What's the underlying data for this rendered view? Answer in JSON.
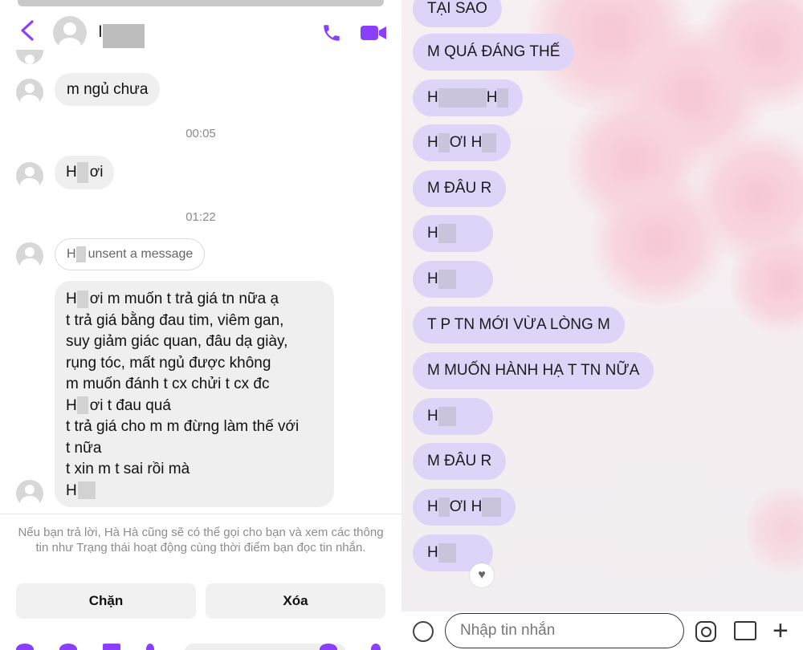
{
  "left": {
    "header": {
      "name_initial": "I",
      "call_icon": "phone-icon",
      "video_icon": "video-call-icon",
      "back_icon": "chevron-left-icon"
    },
    "messages": [
      {
        "text": "m ngủ chưa"
      },
      {
        "time": "00:05"
      },
      {
        "prefix": "H",
        "text": "ơi"
      },
      {
        "time": "01:22"
      },
      {
        "prefix": "H",
        "text": "unsent a message"
      }
    ],
    "long_message": [
      {
        "prefix": "H",
        "text": "ơi m muốn t trả giá tn nữa ạ"
      },
      {
        "text": "t trả giá bằng đau tim, viêm gan,"
      },
      {
        "text": "suy giảm giác quan, đâu dạ giày,"
      },
      {
        "text": "rụng tóc, mất ngủ được không"
      },
      {
        "text": "m muốn đánh t cx chửi t cx đc"
      },
      {
        "prefix": "H",
        "text": "ơi t đau quá"
      },
      {
        "text": "t trả giá cho m m đừng làm thế với"
      },
      {
        "text": "t nữa"
      },
      {
        "text": "t xin m t sai rồi mà"
      },
      {
        "prefix": "H",
        "text": ""
      }
    ],
    "notice": "Nếu bạn trả lời, Hà Hà cũng sẽ có thể gọi cho bạn và xem các thông tin như Trạng thái hoạt động cùng thời điểm bạn đọc tin nhắn.",
    "buttons": {
      "block": "Chặn",
      "delete": "Xóa"
    }
  },
  "right": {
    "messages": [
      {
        "text": "TẠI SAO"
      },
      {
        "text": "M QUÁ ĐÁNG THẾ"
      },
      {
        "prefix": "H",
        "suffix": "H",
        "text": ""
      },
      {
        "prefix": "H",
        "text": "ƠI H"
      },
      {
        "text": "M ĐÂU R"
      },
      {
        "prefix": "H",
        "text": ""
      },
      {
        "prefix": "H",
        "text": ""
      },
      {
        "text": "T P TN MỚI VỪA LÒNG M"
      },
      {
        "text": "M MUỐN HÀNH HẠ T TN NỮA"
      },
      {
        "prefix": "H",
        "text": ""
      },
      {
        "text": "M ĐÂU R"
      },
      {
        "prefix": "H",
        "text": "ƠI H"
      },
      {
        "prefix": "H",
        "text": ""
      }
    ],
    "input_placeholder": "Nhập tin nhắn",
    "icons": [
      "emoji-icon",
      "instagram-icon",
      "image-icon",
      "plus-icon",
      "heart-icon"
    ]
  },
  "colors": {
    "accent": "#8a3ffc",
    "right_bubble": "#ddd4f7",
    "left_bubble": "#efefef"
  }
}
